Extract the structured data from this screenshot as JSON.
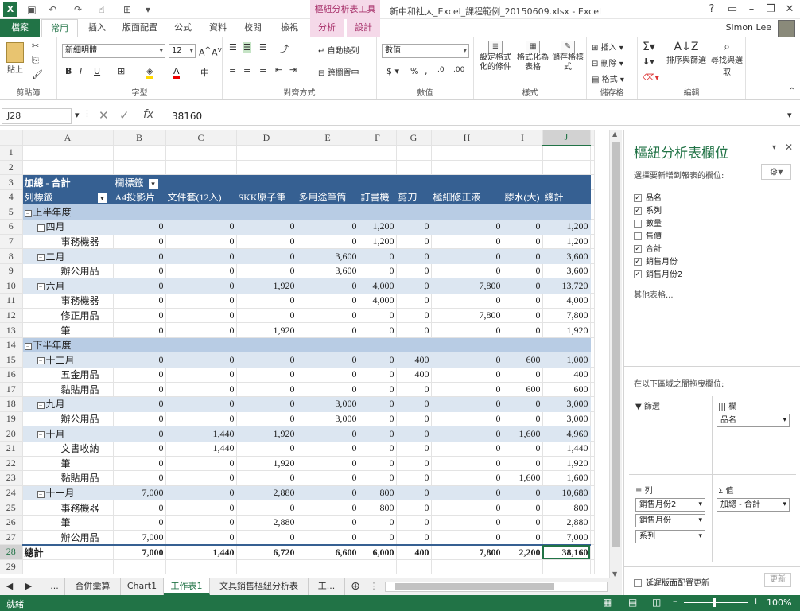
{
  "window": {
    "title": "新中和社大_Excel_課程範例_20150609.xlsx - Excel",
    "context_tab_group": "樞紐分析表工具",
    "user": "Simon Lee"
  },
  "tabs": [
    "檔案",
    "常用",
    "插入",
    "版面配置",
    "公式",
    "資料",
    "校閱",
    "檢視",
    "分析",
    "設計"
  ],
  "ribbon": {
    "clipboard": {
      "label": "剪貼簿",
      "paste": "貼上"
    },
    "font": {
      "label": "字型",
      "name": "新細明體",
      "size": "12"
    },
    "alignment": {
      "label": "對齊方式",
      "wrap": "自動換列",
      "merge": "跨欄置中"
    },
    "number": {
      "label": "數值",
      "format": "數值"
    },
    "styles": {
      "label": "樣式",
      "conditional": "設定格式化的條件",
      "table": "格式化為表格",
      "cell": "儲存格樣式"
    },
    "cells": {
      "label": "儲存格",
      "insert": "插入",
      "delete": "刪除",
      "format": "格式"
    },
    "editing": {
      "label": "編輯",
      "sort": "排序與篩選",
      "find": "尋找與選取"
    }
  },
  "formula_bar": {
    "name_box": "J28",
    "value": "38160"
  },
  "columns": [
    "A",
    "B",
    "C",
    "D",
    "E",
    "F",
    "G",
    "H",
    "I",
    "J"
  ],
  "pivot": {
    "corner": "加總 - 合計",
    "col_label": "欄標籤",
    "row_label": "列標籤",
    "headers": [
      "A4投影片",
      "文件套(12入)",
      "SKK原子筆",
      "多用途筆筒",
      "訂書機",
      "剪刀",
      "極細修正液",
      "膠水(大)",
      "總計"
    ],
    "rows": [
      {
        "r": 1,
        "type": "blank",
        "label": "",
        "v": []
      },
      {
        "r": 2,
        "type": "blank",
        "label": "",
        "v": []
      },
      {
        "r": 5,
        "type": "half",
        "label": "上半年度",
        "v": []
      },
      {
        "r": 6,
        "type": "mon",
        "label": "四月",
        "v": [
          "0",
          "0",
          "0",
          "0",
          "1,200",
          "0",
          "0",
          "0",
          "1,200"
        ]
      },
      {
        "r": 7,
        "type": "item",
        "label": "事務機器",
        "v": [
          "0",
          "0",
          "0",
          "0",
          "1,200",
          "0",
          "0",
          "0",
          "1,200"
        ]
      },
      {
        "r": 8,
        "type": "mon",
        "label": "二月",
        "v": [
          "0",
          "0",
          "0",
          "3,600",
          "0",
          "0",
          "0",
          "0",
          "3,600"
        ]
      },
      {
        "r": 9,
        "type": "item",
        "label": "辦公用品",
        "v": [
          "0",
          "0",
          "0",
          "3,600",
          "0",
          "0",
          "0",
          "0",
          "3,600"
        ]
      },
      {
        "r": 10,
        "type": "mon",
        "label": "六月",
        "v": [
          "0",
          "0",
          "1,920",
          "0",
          "4,000",
          "0",
          "7,800",
          "0",
          "13,720"
        ]
      },
      {
        "r": 11,
        "type": "item",
        "label": "事務機器",
        "v": [
          "0",
          "0",
          "0",
          "0",
          "4,000",
          "0",
          "0",
          "0",
          "4,000"
        ]
      },
      {
        "r": 12,
        "type": "item",
        "label": "修正用品",
        "v": [
          "0",
          "0",
          "0",
          "0",
          "0",
          "0",
          "7,800",
          "0",
          "7,800"
        ]
      },
      {
        "r": 13,
        "type": "item",
        "label": "筆",
        "v": [
          "0",
          "0",
          "1,920",
          "0",
          "0",
          "0",
          "0",
          "0",
          "1,920"
        ]
      },
      {
        "r": 14,
        "type": "half",
        "label": "下半年度",
        "v": []
      },
      {
        "r": 15,
        "type": "mon",
        "label": "十二月",
        "v": [
          "0",
          "0",
          "0",
          "0",
          "0",
          "400",
          "0",
          "600",
          "1,000"
        ]
      },
      {
        "r": 16,
        "type": "item",
        "label": "五金用品",
        "v": [
          "0",
          "0",
          "0",
          "0",
          "0",
          "400",
          "0",
          "0",
          "400"
        ]
      },
      {
        "r": 17,
        "type": "item",
        "label": "黏貼用品",
        "v": [
          "0",
          "0",
          "0",
          "0",
          "0",
          "0",
          "0",
          "600",
          "600"
        ]
      },
      {
        "r": 18,
        "type": "mon",
        "label": "九月",
        "v": [
          "0",
          "0",
          "0",
          "3,000",
          "0",
          "0",
          "0",
          "0",
          "3,000"
        ]
      },
      {
        "r": 19,
        "type": "item",
        "label": "辦公用品",
        "v": [
          "0",
          "0",
          "0",
          "3,000",
          "0",
          "0",
          "0",
          "0",
          "3,000"
        ]
      },
      {
        "r": 20,
        "type": "mon",
        "label": "十月",
        "v": [
          "0",
          "1,440",
          "1,920",
          "0",
          "0",
          "0",
          "0",
          "1,600",
          "4,960"
        ]
      },
      {
        "r": 21,
        "type": "item",
        "label": "文書收納",
        "v": [
          "0",
          "1,440",
          "0",
          "0",
          "0",
          "0",
          "0",
          "0",
          "1,440"
        ]
      },
      {
        "r": 22,
        "type": "item",
        "label": "筆",
        "v": [
          "0",
          "0",
          "1,920",
          "0",
          "0",
          "0",
          "0",
          "0",
          "1,920"
        ]
      },
      {
        "r": 23,
        "type": "item",
        "label": "黏貼用品",
        "v": [
          "0",
          "0",
          "0",
          "0",
          "0",
          "0",
          "0",
          "1,600",
          "1,600"
        ]
      },
      {
        "r": 24,
        "type": "mon",
        "label": "十一月",
        "v": [
          "7,000",
          "0",
          "2,880",
          "0",
          "800",
          "0",
          "0",
          "0",
          "10,680"
        ]
      },
      {
        "r": 25,
        "type": "item",
        "label": "事務機器",
        "v": [
          "0",
          "0",
          "0",
          "0",
          "800",
          "0",
          "0",
          "0",
          "800"
        ]
      },
      {
        "r": 26,
        "type": "item",
        "label": "筆",
        "v": [
          "0",
          "0",
          "2,880",
          "0",
          "0",
          "0",
          "0",
          "0",
          "2,880"
        ]
      },
      {
        "r": 27,
        "type": "item",
        "label": "辦公用品",
        "v": [
          "7,000",
          "0",
          "0",
          "0",
          "0",
          "0",
          "0",
          "0",
          "7,000"
        ]
      },
      {
        "r": 28,
        "type": "tot",
        "label": "總計",
        "v": [
          "7,000",
          "1,440",
          "6,720",
          "6,600",
          "6,000",
          "400",
          "7,800",
          "2,200",
          "38,160"
        ]
      },
      {
        "r": 29,
        "type": "blank",
        "label": "",
        "v": []
      }
    ]
  },
  "sheet_tabs": [
    "...",
    "合併彙算",
    "Chart1",
    "工作表1",
    "文具銷售樞紐分析表",
    "工..."
  ],
  "active_sheet": "工作表1",
  "status": {
    "ready": "就緒",
    "zoom": "100%"
  },
  "pane": {
    "title": "樞紐分析表欄位",
    "subtitle": "選擇要新增到報表的欄位:",
    "fields": [
      {
        "name": "品名",
        "checked": true
      },
      {
        "name": "系列",
        "checked": true
      },
      {
        "name": "數量",
        "checked": false
      },
      {
        "name": "售價",
        "checked": false
      },
      {
        "name": "合計",
        "checked": true
      },
      {
        "name": "銷售月份",
        "checked": true
      },
      {
        "name": "銷售月份2",
        "checked": true
      }
    ],
    "more": "其他表格...",
    "drag_hint": "在以下區域之間拖曳欄位:",
    "filters": "篩選",
    "columns": "欄",
    "rows": "列",
    "values": "值",
    "col_items": [
      "品名"
    ],
    "row_items": [
      "銷售月份2",
      "銷售月份",
      "系列"
    ],
    "value_items": [
      "加總 - 合計"
    ],
    "defer": "延遲版面配置更新",
    "update": "更新"
  }
}
